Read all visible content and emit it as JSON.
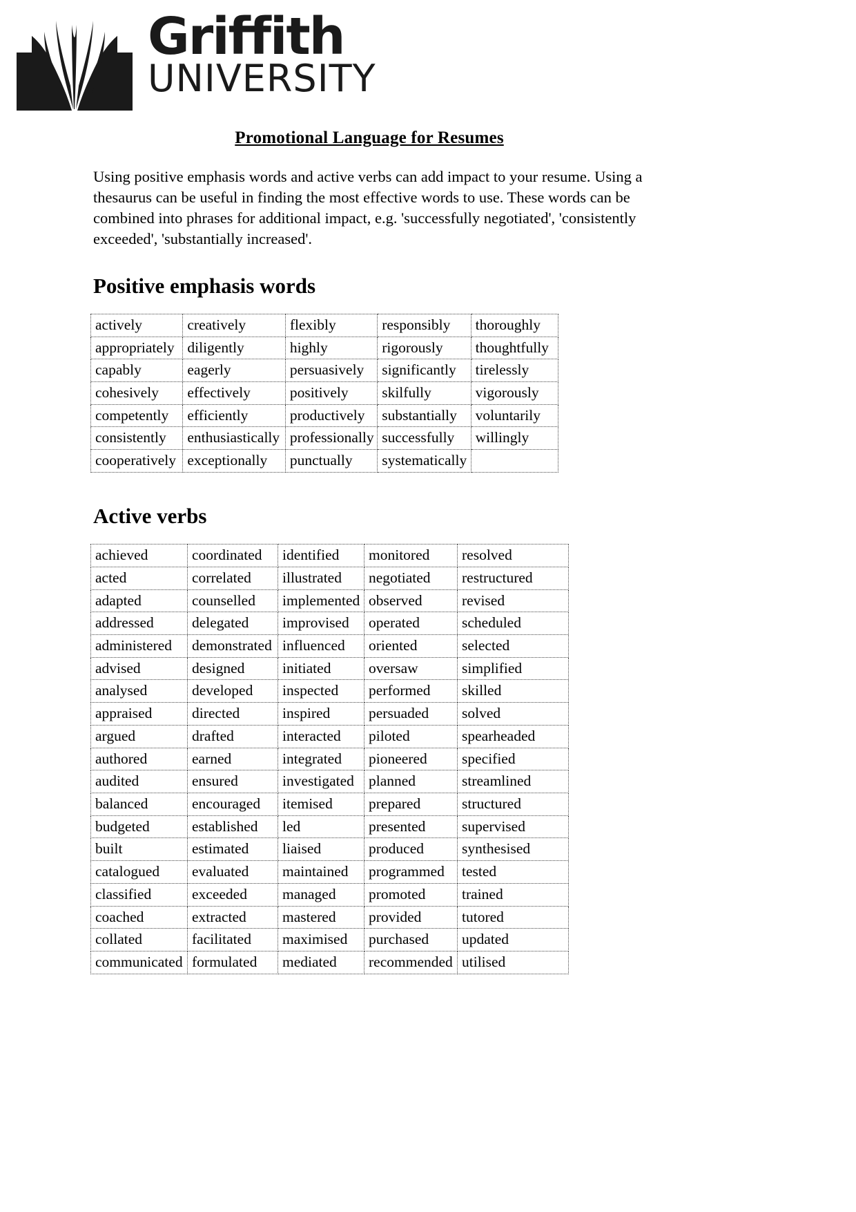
{
  "logo": {
    "name": "Griffith",
    "subtitle": "UNIVERSITY",
    "mark": "griffith-book-flame-mark"
  },
  "document": {
    "title": "Promotional Language for Resumes",
    "intro": "Using positive emphasis words and active verbs can add impact to your resume. Using a thesaurus can be useful in finding the most effective words to use. These words can be combined into phrases for additional impact, e.g. 'successfully negotiated', 'consistently exceeded', 'substantially increased'."
  },
  "sections": [
    {
      "heading": "Positive emphasis words",
      "table": [
        [
          "actively",
          "creatively",
          "flexibly",
          "responsibly",
          "thoroughly"
        ],
        [
          "appropriately",
          "diligently",
          "highly",
          "rigorously",
          "thoughtfully"
        ],
        [
          "capably",
          "eagerly",
          "persuasively",
          "significantly",
          "tirelessly"
        ],
        [
          "cohesively",
          "effectively",
          "positively",
          "skilfully",
          "vigorously"
        ],
        [
          "competently",
          "efficiently",
          "productively",
          "substantially",
          "voluntarily"
        ],
        [
          "consistently",
          "enthusiastically",
          "professionally",
          "successfully",
          "willingly"
        ],
        [
          "cooperatively",
          "exceptionally",
          "punctually",
          "systematically",
          ""
        ]
      ]
    },
    {
      "heading": "Active verbs",
      "table": [
        [
          "achieved",
          "coordinated",
          "identified",
          "monitored",
          "resolved"
        ],
        [
          "acted",
          "correlated",
          "illustrated",
          "negotiated",
          "restructured"
        ],
        [
          "adapted",
          "counselled",
          "implemented",
          "observed",
          "revised"
        ],
        [
          "addressed",
          "delegated",
          "improvised",
          "operated",
          "scheduled"
        ],
        [
          "administered",
          "demonstrated",
          "influenced",
          "oriented",
          "selected"
        ],
        [
          "advised",
          "designed",
          "initiated",
          "oversaw",
          "simplified"
        ],
        [
          "analysed",
          "developed",
          "inspected",
          "performed",
          "skilled"
        ],
        [
          "appraised",
          "directed",
          "inspired",
          "persuaded",
          "solved"
        ],
        [
          "argued",
          "drafted",
          "interacted",
          "piloted",
          "spearheaded"
        ],
        [
          "authored",
          "earned",
          "integrated",
          "pioneered",
          "specified"
        ],
        [
          "audited",
          "ensured",
          "investigated",
          "planned",
          "streamlined"
        ],
        [
          "balanced",
          "encouraged",
          "itemised",
          "prepared",
          "structured"
        ],
        [
          "budgeted",
          "established",
          "led",
          "presented",
          "supervised"
        ],
        [
          "built",
          "estimated",
          "liaised",
          "produced",
          "synthesised"
        ],
        [
          "catalogued",
          "evaluated",
          "maintained",
          "programmed",
          "tested"
        ],
        [
          "classified",
          "exceeded",
          "managed",
          "promoted",
          "trained"
        ],
        [
          "coached",
          "extracted",
          "mastered",
          "provided",
          "tutored"
        ],
        [
          "collated",
          "facilitated",
          "maximised",
          "purchased",
          "updated"
        ],
        [
          "communicated",
          "formulated",
          "mediated",
          "recommended",
          "utilised"
        ]
      ]
    }
  ],
  "colors": {
    "text": "#000000",
    "background": "#ffffff",
    "table_border": "#444444"
  }
}
